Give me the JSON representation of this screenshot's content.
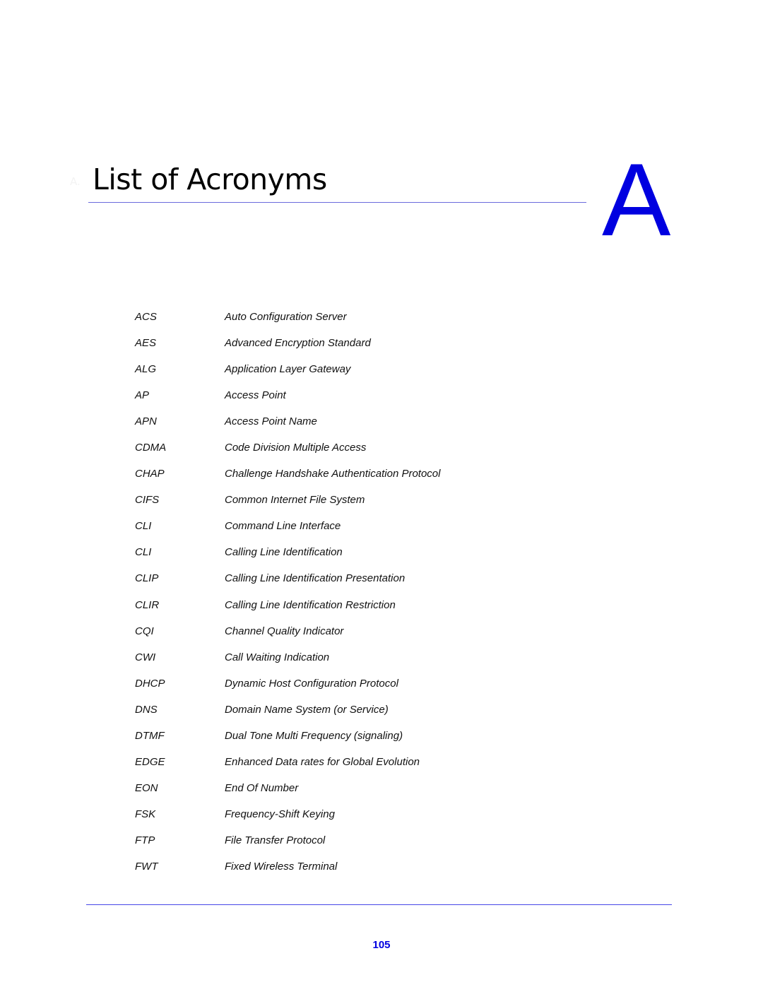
{
  "header": {
    "chapter_marker": "A.",
    "title": "List of Acronyms",
    "chapter_letter": "A"
  },
  "colors": {
    "accent": "#0000e0",
    "rule": "#6b6bdc",
    "text": "#111111"
  },
  "acronyms": [
    {
      "term": "ACS",
      "definition": "Auto Configuration Server"
    },
    {
      "term": "AES",
      "definition": "Advanced Encryption Standard"
    },
    {
      "term": "ALG",
      "definition": "Application Layer Gateway"
    },
    {
      "term": "AP",
      "definition": "Access Point"
    },
    {
      "term": "APN",
      "definition": "Access Point Name"
    },
    {
      "term": "CDMA",
      "definition": "Code Division Multiple Access"
    },
    {
      "term": "CHAP",
      "definition": "Challenge Handshake Authentication Protocol"
    },
    {
      "term": "CIFS",
      "definition": "Common Internet File System"
    },
    {
      "term": "CLI",
      "definition": "Command Line Interface"
    },
    {
      "term": "CLI",
      "definition": "Calling Line Identification"
    },
    {
      "term": "CLIP",
      "definition": "Calling Line Identification Presentation"
    },
    {
      "term": "CLIR",
      "definition": "Calling Line Identification Restriction"
    },
    {
      "term": "CQI",
      "definition": "Channel Quality Indicator"
    },
    {
      "term": "CWI",
      "definition": "Call Waiting Indication"
    },
    {
      "term": "DHCP",
      "definition": "Dynamic Host Configuration Protocol"
    },
    {
      "term": "DNS",
      "definition": "Domain Name System (or Service)"
    },
    {
      "term": "DTMF",
      "definition": "Dual Tone Multi Frequency (signaling)"
    },
    {
      "term": "EDGE",
      "definition": "Enhanced Data rates for Global Evolution"
    },
    {
      "term": "EON",
      "definition": "End Of Number"
    },
    {
      "term": "FSK",
      "definition": "Frequency-Shift Keying"
    },
    {
      "term": "FTP",
      "definition": "File Transfer Protocol"
    },
    {
      "term": "FWT",
      "definition": "Fixed Wireless Terminal"
    }
  ],
  "footer": {
    "page_number": "105"
  }
}
